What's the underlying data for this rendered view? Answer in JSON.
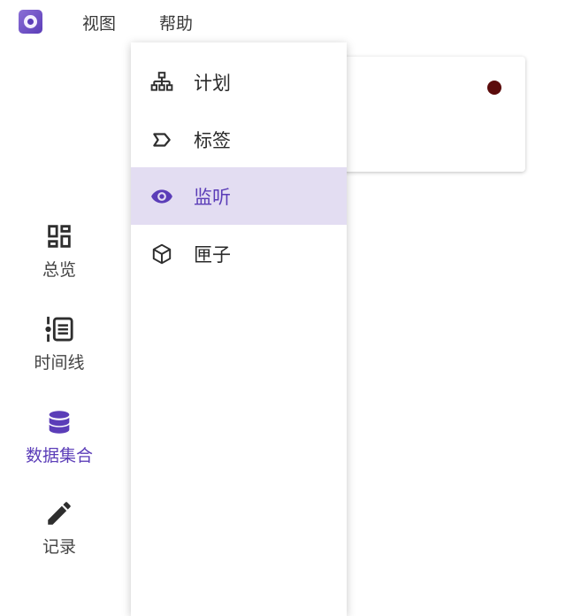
{
  "menubar": {
    "view_label": "视图",
    "help_label": "帮助"
  },
  "dropdown": {
    "items": [
      {
        "label": "计划",
        "icon": "sitemap-icon",
        "selected": false
      },
      {
        "label": "标签",
        "icon": "label-outline-icon",
        "selected": false
      },
      {
        "label": "监听",
        "icon": "eye-icon",
        "selected": true
      },
      {
        "label": "匣子",
        "icon": "cube-outline-icon",
        "selected": false
      }
    ]
  },
  "sidebar": {
    "items": [
      {
        "label": "总览",
        "icon": "dashboard-icon",
        "active": false
      },
      {
        "label": "时间线",
        "icon": "timeline-icon",
        "active": false
      },
      {
        "label": "数据集合",
        "icon": "database-icon",
        "active": true
      },
      {
        "label": "记录",
        "icon": "pencil-icon",
        "active": false
      }
    ]
  },
  "card": {
    "status_color": "#5b0b0b"
  },
  "colors": {
    "accent": "#5b3db8",
    "selected_bg": "#e3ddf2",
    "icon": "#2e2e2e"
  }
}
